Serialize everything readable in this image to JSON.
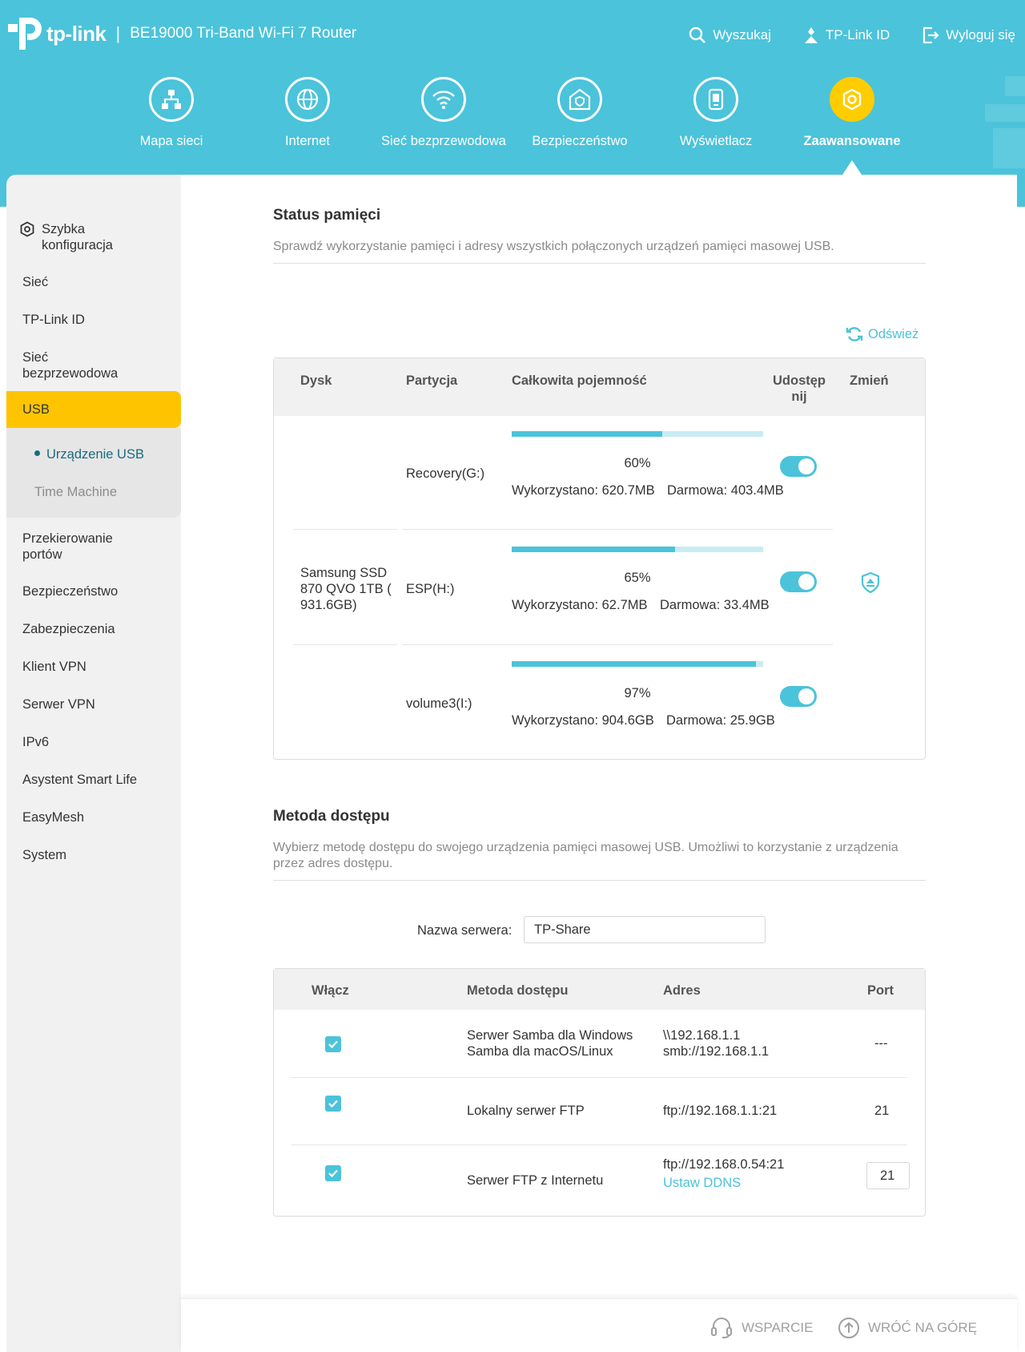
{
  "header": {
    "brand": "tp-link",
    "model": "BE19000 Tri-Band Wi-Fi 7 Router",
    "links": {
      "search": "Wyszukaj",
      "tplink_id": "TP-Link ID",
      "logout": "Wyloguj się"
    }
  },
  "nav": [
    {
      "label": "Mapa sieci",
      "icon": "network-map-icon"
    },
    {
      "label": "Internet",
      "icon": "globe-icon"
    },
    {
      "label": "Sieć bezprzewodowa",
      "icon": "wifi-icon"
    },
    {
      "label": "Bezpieczeństwo",
      "icon": "shield-house-icon"
    },
    {
      "label": "Wyświetlacz",
      "icon": "display-icon"
    },
    {
      "label": "Zaawansowane",
      "icon": "gear-icon",
      "active": true
    }
  ],
  "sidebar": {
    "quick_setup": "Szybka konfiguracja",
    "items": [
      "Sieć",
      "TP-Link ID",
      "Sieć bezprzewodowa",
      "USB"
    ],
    "usb_sub": [
      "Urządzenie USB",
      "Time Machine"
    ],
    "items_after": [
      "Przekierowanie portów",
      "Bezpieczeństwo",
      "Zabezpieczenia",
      "Klient VPN",
      "Serwer VPN",
      "IPv6",
      "Asystent Smart Life",
      "EasyMesh",
      "System"
    ]
  },
  "storage": {
    "title": "Status pamięci",
    "desc": "Sprawdź wykorzystanie pamięci i adresy wszystkich połączonych urządzeń pamięci masowej USB.",
    "refresh": "Odśwież",
    "headers": {
      "disk": "Dysk",
      "partition": "Partycja",
      "capacity": "Całkowita pojemność",
      "share": "Udostęp nij",
      "change": "Zmień"
    },
    "disk_name": "Samsung   SSD  870 QVO 1TB ( 931.6GB)",
    "partitions": [
      {
        "name": "Recovery(G:)",
        "percent": "60%",
        "fill": 0.6,
        "used": "Wykorzystano: 620.7MB",
        "free": "Darmowa: 403.4MB",
        "shared": true
      },
      {
        "name": "ESP(H:)",
        "percent": "65%",
        "fill": 0.65,
        "used": "Wykorzystano: 62.7MB",
        "free": "Darmowa: 33.4MB",
        "shared": true
      },
      {
        "name": "volume3(I:)",
        "percent": "97%",
        "fill": 0.97,
        "used": "Wykorzystano: 904.6GB",
        "free": "Darmowa: 25.9GB",
        "shared": true
      }
    ]
  },
  "access": {
    "title": "Metoda dostępu",
    "desc": "Wybierz metodę dostępu do swojego urządzenia pamięci masowej USB. Umożliwi to korzystanie z urządzenia przez adres dostępu.",
    "server_label": "Nazwa serwera:",
    "server_value": "TP-Share",
    "headers": {
      "enable": "Włącz",
      "method": "Metoda dostępu",
      "address": "Adres",
      "port": "Port"
    },
    "rows": [
      {
        "method1": "Serwer Samba dla Windows",
        "method2": "Samba dla macOS/Linux",
        "addr1": "\\\\192.168.1.1",
        "addr2": "smb://192.168.1.1",
        "port": "---"
      },
      {
        "method1": "Lokalny serwer FTP",
        "addr1": "ftp://192.168.1.1:21",
        "port": "21"
      },
      {
        "method1": "Serwer FTP z Internetu",
        "addr1": "ftp://192.168.0.54:21",
        "ddns": "Ustaw DDNS",
        "port": "21"
      }
    ]
  },
  "footer": {
    "support": "WSPARCIE",
    "back_top": "WRÓĆ NA GÓRĘ"
  },
  "colors": {
    "accent": "#4bc3da",
    "active_yellow": "#ffc400"
  }
}
